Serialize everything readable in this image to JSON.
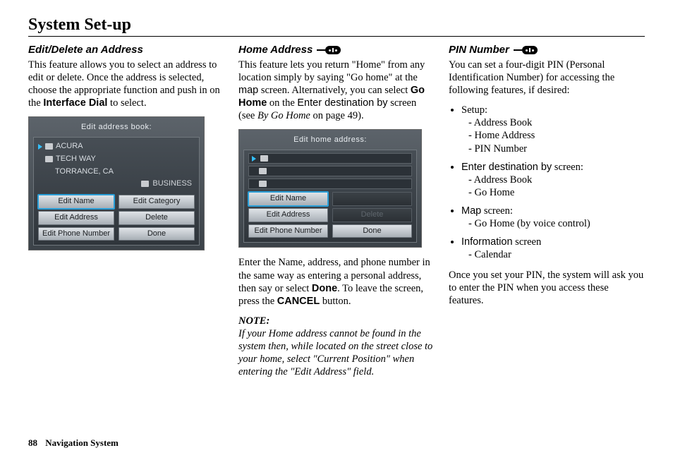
{
  "page": {
    "title": "System Set-up",
    "footer_page": "88",
    "footer_label": "Navigation System"
  },
  "col1": {
    "heading": "Edit/Delete an Address",
    "p1a": "This feature allows you to select an address to edit or delete. Once the address is selected, choose the appropriate function and push in on the ",
    "p1b": "Interface Dial",
    "p1c": " to select.",
    "device": {
      "title": "Edit address book:",
      "line1": "ACURA",
      "line2": "TECH WAY",
      "line3": "TORRANCE, CA",
      "tag": "BUSINESS",
      "btn1": "Edit Name",
      "btn2": "Edit Category",
      "btn3": "Edit Address",
      "btn4": "Delete",
      "btn5": "Edit Phone Number",
      "btn6": "Done"
    }
  },
  "col2": {
    "heading": "Home Address",
    "p1a": "This feature lets you return \"Home\" from any location simply by saying \"Go home\" at the ",
    "p1b": "map",
    "p1c": " screen. Alternatively, you can select ",
    "p1d": "Go Home",
    "p1e": " on the ",
    "p1f": "Enter destination by",
    "p1g": " screen (see ",
    "p1h": "By Go Home",
    "p1i": " on page 49).",
    "device": {
      "title": "Edit home address:",
      "btn1": "Edit Name",
      "btn2": "",
      "btn3": "Edit Address",
      "btn4": "Delete",
      "btn5": "Edit Phone Number",
      "btn6": "Done"
    },
    "p2a": "Enter the Name, address, and phone number in the same way as entering a personal address, then say or select ",
    "p2b": "Done",
    "p2c": ". To leave the screen, press the ",
    "p2d": "CANCEL",
    "p2e": " button.",
    "note_head": "NOTE:",
    "note_body": "If your Home address cannot be found in the system then, while located on the street close to your home, select \"Current Position\" when entering the \"Edit Address\" field."
  },
  "col3": {
    "heading": "PIN Number",
    "p1": "You can set a four-digit PIN (Personal Identification Number) for accessing the following features, if desired:",
    "b1": {
      "label": "Setup:",
      "i1": "Address Book",
      "i2": "Home Address",
      "i3": "PIN Number"
    },
    "b2": {
      "label_sans": "Enter destination by",
      "label_tail": " screen:",
      "i1": "Address Book",
      "i2": "Go Home"
    },
    "b3": {
      "label_sans": "Map",
      "label_tail": " screen:",
      "i1": "Go Home (by voice control)"
    },
    "b4": {
      "label_sans": "Information",
      "label_tail": " screen",
      "i1": "Calendar"
    },
    "p2": "Once you set your PIN, the system will ask you to enter the PIN when you access these features."
  }
}
